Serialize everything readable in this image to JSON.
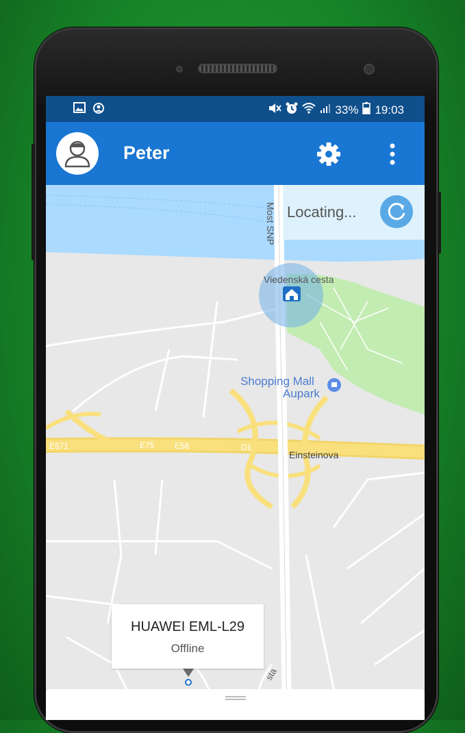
{
  "status_bar": {
    "battery_percent": "33%",
    "time": "19:03",
    "left_icons": [
      "gallery-icon",
      "vpn-icon"
    ],
    "right_icons": [
      "mute-icon",
      "alarm-icon",
      "wifi-icon",
      "signal-icon",
      "battery-icon"
    ]
  },
  "app_bar": {
    "title": "Peter",
    "icons": [
      "avatar-icon",
      "settings-gear-icon",
      "overflow-menu-icon"
    ]
  },
  "locating": {
    "label": "Locating...",
    "icon": "refresh-icon"
  },
  "map": {
    "labels": {
      "bridge": "Most SNP",
      "street_top": "Viedenská cesta",
      "poi": "Shopping Mall\nAupark",
      "poi_line1": "Shopping Mall",
      "poi_line2": "Aupark",
      "street_einstein": "Einsteinova",
      "road_e571": "E571",
      "road_e75": "E75",
      "road_e58": "E58",
      "road_d1": "D1",
      "street_bottom": "sta"
    },
    "colors": {
      "water": "#aadaff",
      "park": "#c3ecb2",
      "highway": "#f9e07d",
      "land": "#e8e8e8"
    }
  },
  "device_callout": {
    "name": "HUAWEI EML-L29",
    "status": "Offline"
  },
  "colors": {
    "app_bar": "#1976d2",
    "status_bar": "#0f4f8c",
    "accent": "#5aa9e6"
  }
}
